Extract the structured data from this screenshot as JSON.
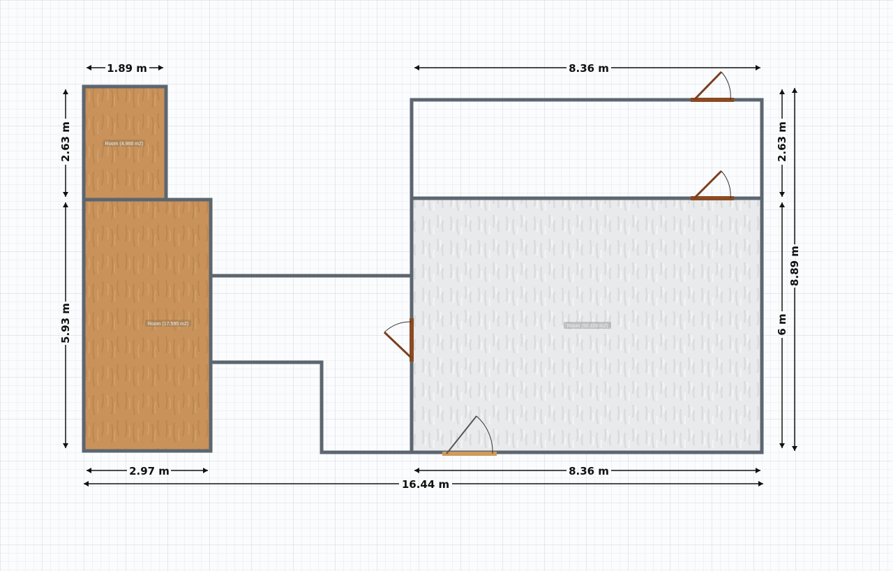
{
  "plan": {
    "rooms": [
      {
        "label": "Room (4.966 m2)"
      },
      {
        "label": "Room (17.595 m2)"
      },
      {
        "label": "Room (50.328 m2)"
      }
    ],
    "dimensions": {
      "top_left_width": "1.89 m",
      "top_right_width": "8.36 m",
      "left_upper_height": "2.63 m",
      "left_lower_height": "5.93 m",
      "right_upper_height": "2.63 m",
      "right_lower_height": "6 m",
      "right_total_height": "8.89 m",
      "bottom_left_width": "2.97 m",
      "bottom_right_width": "8.36 m",
      "overall_width": "16.44 m"
    }
  },
  "colors": {
    "wall": "#5c6670",
    "wood_floor": "#c8925a",
    "tile_floor": "#e9eaec",
    "door": "#8a4a22",
    "dimension_line": "#111111",
    "grid_minor": "#e4e9ee",
    "grid_major": "#cfd6dd"
  }
}
